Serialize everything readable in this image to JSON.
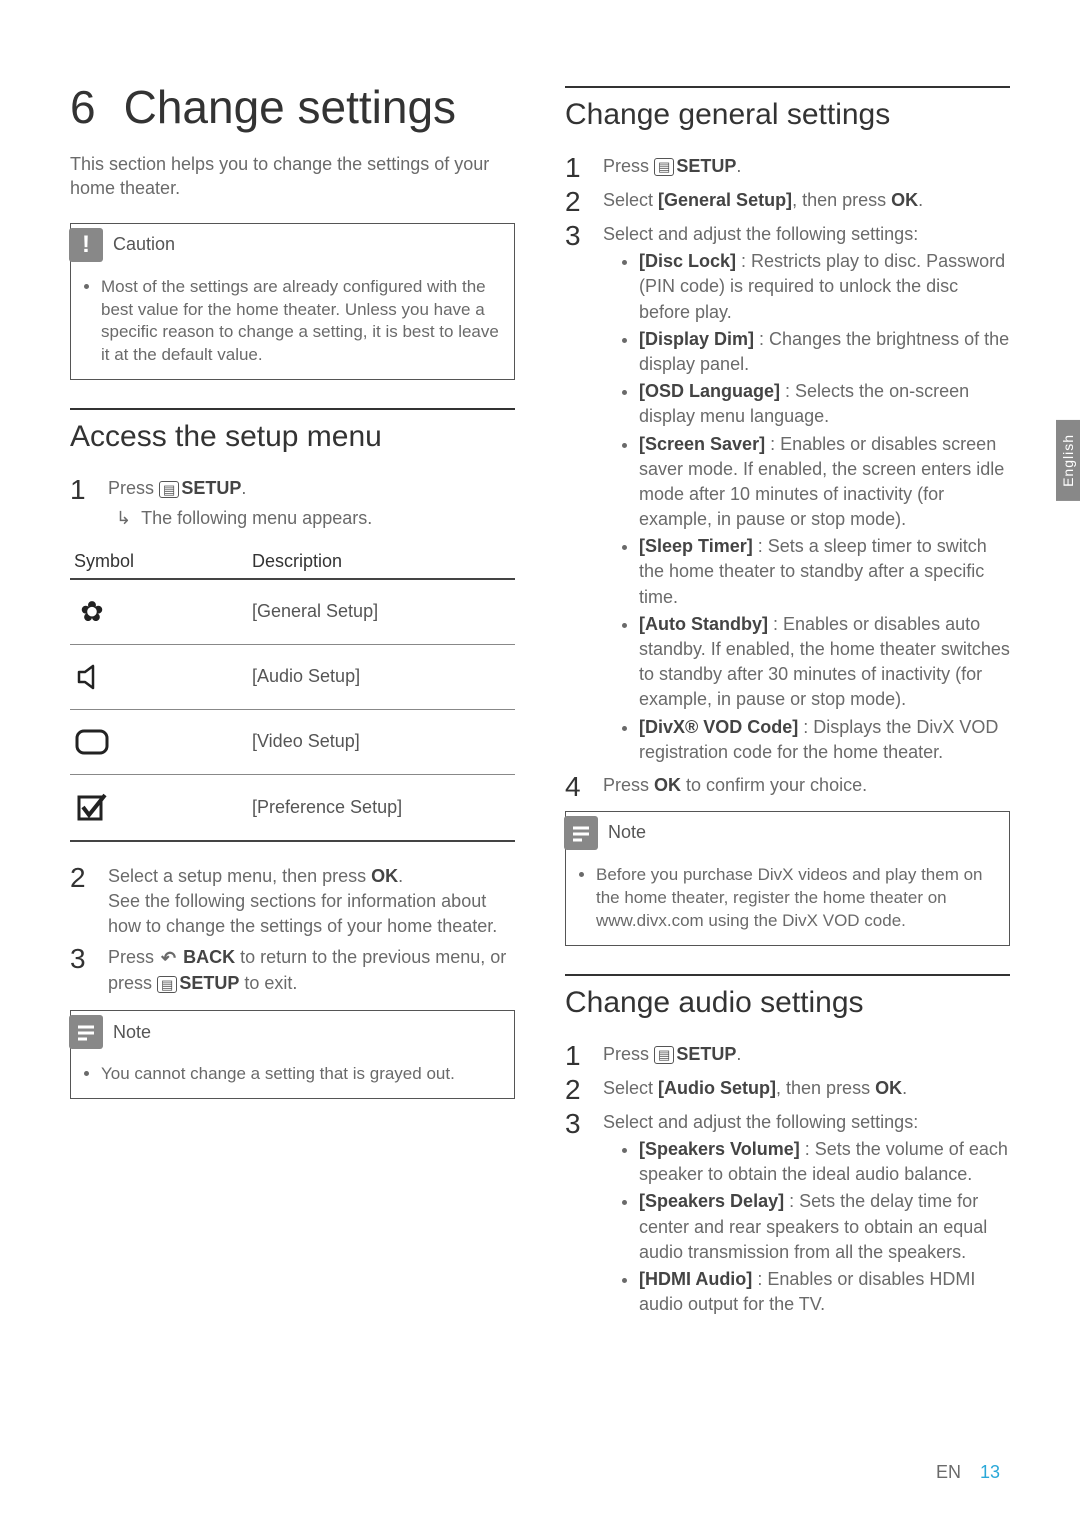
{
  "side_tab": "English",
  "left": {
    "chapter_num": "6",
    "chapter_title": "Change settings",
    "intro": "This section helps you to change the settings of your home theater.",
    "caution_label": "Caution",
    "caution_glyph": "!",
    "caution_text": "Most of the settings are already configured with the best value for the home theater. Unless you have a specific reason to change a setting, it is best to leave it at the default value.",
    "access_title": "Access the setup menu",
    "step1_press": "Press ",
    "step1_setup": "SETUP",
    "step1_dot": ".",
    "step1_sub": "The following menu appears.",
    "table": {
      "h1": "Symbol",
      "h2": "Description",
      "rows": [
        {
          "label": "[General Setup]"
        },
        {
          "label": "[Audio Setup]"
        },
        {
          "label": "[Video Setup]"
        },
        {
          "label": "[Preference Setup]"
        }
      ]
    },
    "step2_a": "Select a setup menu, then press ",
    "step2_ok": "OK",
    "step2_dot": ".",
    "step2_b": "See the following sections for information about how to change the settings of your home theater.",
    "step3_a": "Press ",
    "step3_back": "BACK",
    "step3_b": " to return to the previous menu, or press ",
    "step3_setup": "SETUP",
    "step3_c": " to exit.",
    "note_label": "Note",
    "note_text": "You cannot change a setting that is grayed out."
  },
  "right": {
    "general_title": "Change general settings",
    "g_step1_a": "Press ",
    "g_step1_setup": "SETUP",
    "g_step1_dot": ".",
    "g_step2_a": "Select ",
    "g_step2_b": "[General Setup]",
    "g_step2_c": ", then press ",
    "g_step2_ok": "OK",
    "g_step2_dot": ".",
    "g_step3": "Select and adjust the following settings:",
    "g_items": [
      {
        "b": "[Disc Lock]",
        "t": " : Restricts play to disc. Password (PIN code) is required to unlock the disc before play."
      },
      {
        "b": "[Display Dim]",
        "t": " : Changes the brightness of the display panel."
      },
      {
        "b": "[OSD Language]",
        "t": " : Selects the on-screen display menu language."
      },
      {
        "b": "[Screen Saver]",
        "t": " : Enables or disables screen saver mode. If enabled, the screen enters idle mode after 10 minutes of inactivity (for example, in pause or stop mode)."
      },
      {
        "b": "[Sleep Timer]",
        "t": " : Sets a sleep timer to switch the home theater to standby after a specific time."
      },
      {
        "b": "[Auto Standby]",
        "t": " : Enables or disables auto standby. If enabled, the home theater switches to standby after 30 minutes of inactivity (for example, in pause or stop mode)."
      },
      {
        "b": "[DivX® VOD Code]",
        "t": " : Displays the DivX VOD registration code for the home theater."
      }
    ],
    "g_step4_a": "Press ",
    "g_step4_ok": "OK",
    "g_step4_b": " to confirm your choice.",
    "note_label": "Note",
    "note_text": "Before you purchase DivX videos and play them on the home theater, register the home theater on www.divx.com using the DivX VOD code.",
    "audio_title": "Change audio settings",
    "a_step1_a": "Press ",
    "a_step1_setup": "SETUP",
    "a_step1_dot": ".",
    "a_step2_a": "Select ",
    "a_step2_b": "[Audio Setup]",
    "a_step2_c": ", then press ",
    "a_step2_ok": "OK",
    "a_step2_dot": ".",
    "a_step3": "Select and adjust the following settings:",
    "a_items": [
      {
        "b": "[Speakers Volume]",
        "t": " : Sets the volume of each speaker to obtain the ideal audio balance."
      },
      {
        "b": "[Speakers Delay]",
        "t": " : Sets the delay time for center and rear speakers to obtain an equal audio transmission from all the speakers."
      },
      {
        "b": "[HDMI Audio]",
        "t": " : Enables or disables HDMI audio output for the TV."
      }
    ]
  },
  "footer_lang": "EN",
  "footer_page": "13"
}
